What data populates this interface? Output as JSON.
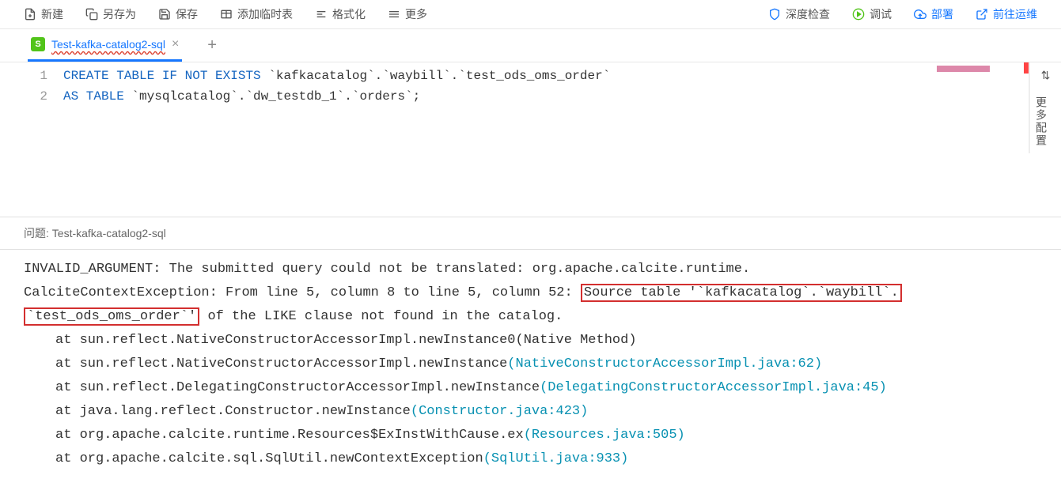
{
  "toolbar": {
    "new": "新建",
    "saveAs": "另存为",
    "save": "保存",
    "addTempTable": "添加临时表",
    "format": "格式化",
    "more": "更多",
    "deepCheck": "深度检查",
    "debug": "调试",
    "deploy": "部署",
    "goOps": "前往运维"
  },
  "tabs": {
    "active": {
      "badge": "S",
      "title": "Test-kafka-catalog2-sql"
    }
  },
  "editor": {
    "lines": [
      {
        "n": "1",
        "tokens": [
          {
            "t": "CREATE TABLE IF NOT EXISTS",
            "c": "kw"
          },
          {
            "t": " `kafkacatalog`.`waybill`.`test_ods_oms_order`",
            "c": "str"
          }
        ]
      },
      {
        "n": "2",
        "tokens": [
          {
            "t": "AS TABLE",
            "c": "kw"
          },
          {
            "t": " `mysqlcatalog`.`dw_testdb_1`.`orders`;",
            "c": "str"
          }
        ]
      }
    ]
  },
  "sidebar": {
    "label": "更多配置",
    "icon": "⇅"
  },
  "panel": {
    "title": "问题: Test-kafka-catalog2-sql",
    "error": {
      "pre1": "INVALID_ARGUMENT: The submitted query could not be translated: org.apache.calcite.runtime.",
      "pre2": "CalciteContextException: From line 5, column 8 to line 5, column 52: ",
      "hl1": "Source table '`kafkacatalog`.`waybill`.",
      "hl2": "`test_ods_oms_order`'",
      "post2": " of the LIKE clause not found in the catalog."
    },
    "stack": [
      {
        "pre": "at sun.reflect.NativeConstructorAccessorImpl.newInstance0(Native Method)",
        "link": ""
      },
      {
        "pre": "at sun.reflect.NativeConstructorAccessorImpl.newInstance",
        "link": "(NativeConstructorAccessorImpl.java:62)"
      },
      {
        "pre": "at sun.reflect.DelegatingConstructorAccessorImpl.newInstance",
        "link": "(DelegatingConstructorAccessorImpl.java:45)"
      },
      {
        "pre": "at java.lang.reflect.Constructor.newInstance",
        "link": "(Constructor.java:423)"
      },
      {
        "pre": "at org.apache.calcite.runtime.Resources$ExInstWithCause.ex",
        "link": "(Resources.java:505)"
      },
      {
        "pre": "at org.apache.calcite.sql.SqlUtil.newContextException",
        "link": "(SqlUtil.java:933)"
      }
    ]
  }
}
